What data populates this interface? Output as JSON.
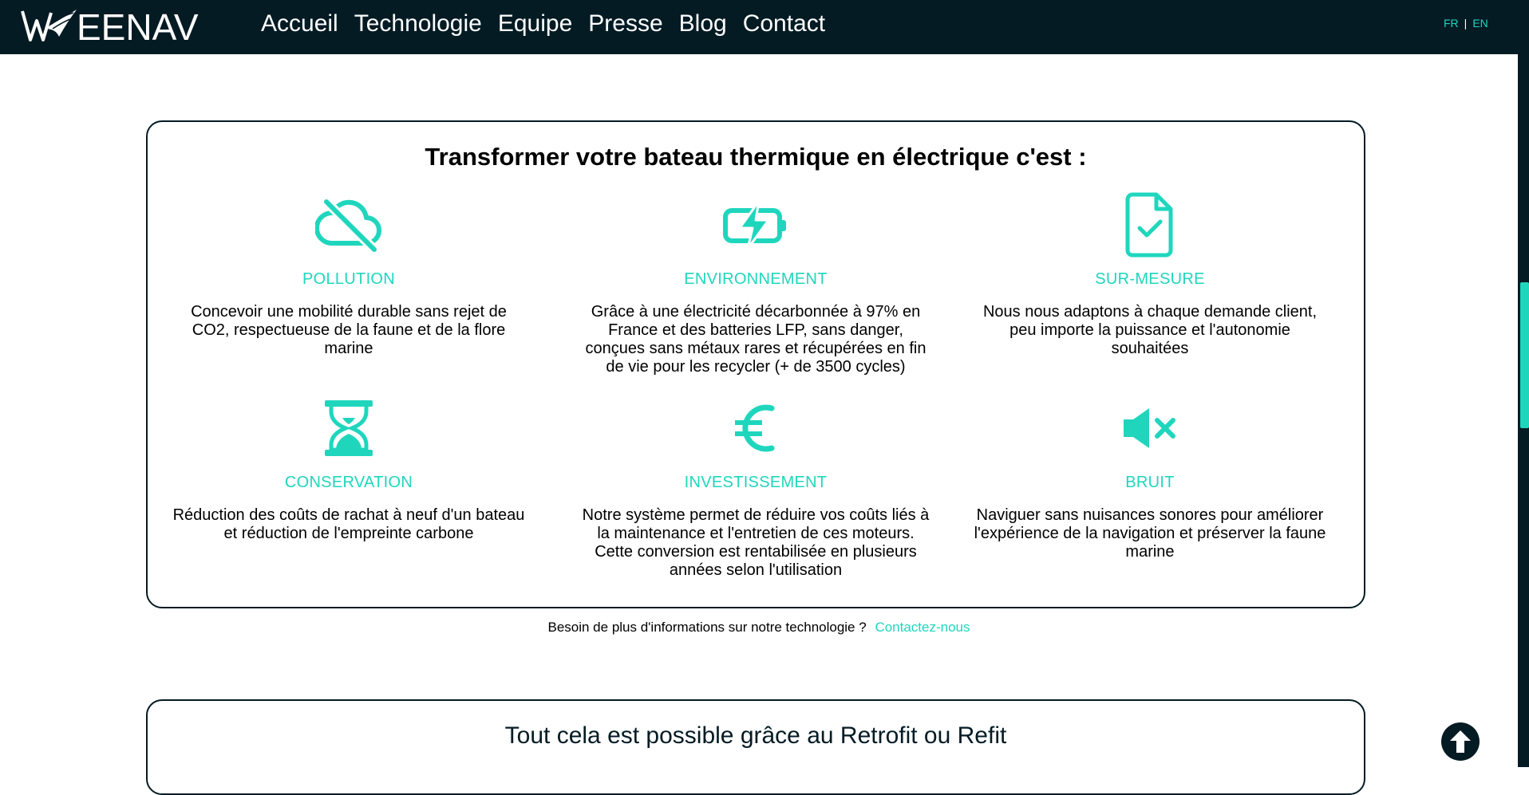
{
  "brand": {
    "logo_text": "WEENAV"
  },
  "nav": {
    "items": [
      "Accueil",
      "Technologie",
      "Equipe",
      "Presse",
      "Blog",
      "Contact"
    ]
  },
  "lang": {
    "fr": "FR",
    "en": "EN"
  },
  "section": {
    "title": "Transformer votre bateau thermique en électrique c'est :",
    "features": [
      {
        "icon": "cloud-off-icon",
        "title": "POLLUTION",
        "desc": "Concevoir une mobilité durable sans rejet de CO2, respectueuse de la faune et de la flore marine"
      },
      {
        "icon": "battery-charging-icon",
        "title": "ENVIRONNEMENT",
        "desc": "Grâce à une électricité décarbonnée à 97% en France et des batteries LFP, sans danger, conçues sans métaux rares et récupérées en fin de vie pour les recycler (+ de 3500 cycles)"
      },
      {
        "icon": "file-check-icon",
        "title": "SUR-MESURE",
        "desc": "Nous nous adaptons à chaque demande client, peu importe la puissance et l'autonomie souhaitées"
      },
      {
        "icon": "hourglass-icon",
        "title": "CONSERVATION",
        "desc": "Réduction des coûts de rachat à neuf d'un bateau et réduction de l'empreinte carbone"
      },
      {
        "icon": "euro-icon",
        "title": "INVESTISSEMENT",
        "desc": "Notre système permet de réduire vos coûts liés à la maintenance et l'entretien de ces moteurs. Cette conversion est rentabilisée en plusieurs années selon l'utilisation"
      },
      {
        "icon": "volume-mute-icon",
        "title": "BRUIT",
        "desc": "Naviguer sans nuisances sonores pour améliorer l'expérience de la navigation et préserver la faune marine"
      }
    ]
  },
  "more_info": {
    "text": "Besoin de plus d'informations sur notre technologie ?",
    "link": "Contactez-nous"
  },
  "retrofit": {
    "title": "Tout cela est possible grâce au Retrofit ou Refit"
  },
  "colors": {
    "accent": "#1fd6bd",
    "dark": "#041b24"
  }
}
